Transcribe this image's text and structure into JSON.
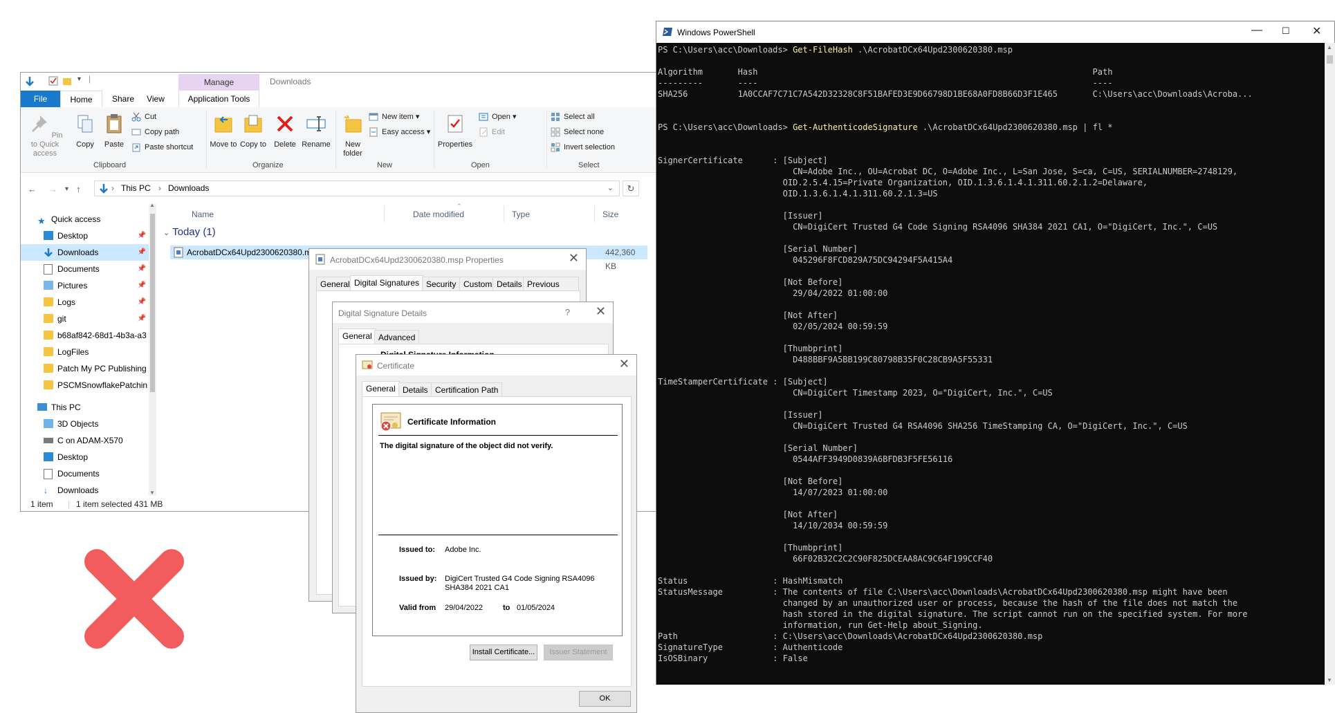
{
  "explorer": {
    "title": "Downloads",
    "manage_tab": "Manage",
    "tabs": {
      "file": "File",
      "home": "Home",
      "share": "Share",
      "view": "View",
      "app_tools": "Application Tools"
    },
    "ribbon": {
      "pin": "Pin to Quick access",
      "copy": "Copy",
      "paste": "Paste",
      "cut": "Cut",
      "copy_path": "Copy path",
      "paste_shortcut": "Paste shortcut",
      "clipboard": "Clipboard",
      "move_to": "Move to",
      "copy_to": "Copy to",
      "delete": "Delete",
      "rename": "Rename",
      "organize": "Organize",
      "new_folder": "New folder",
      "new_item": "New item",
      "easy_access": "Easy access",
      "new": "New",
      "properties": "Properties",
      "open": "Open",
      "edit": "Edit",
      "open_group": "Open",
      "select_all": "Select all",
      "select_none": "Select none",
      "invert_selection": "Invert selection",
      "select": "Select"
    },
    "breadcrumb": {
      "root": "This PC",
      "folder": "Downloads"
    },
    "nav": [
      {
        "label": "Quick access",
        "pinned": false
      },
      {
        "label": "Desktop",
        "pinned": true
      },
      {
        "label": "Downloads",
        "pinned": true
      },
      {
        "label": "Documents",
        "pinned": true
      },
      {
        "label": "Pictures",
        "pinned": true
      },
      {
        "label": "Logs",
        "pinned": true
      },
      {
        "label": "git",
        "pinned": true
      },
      {
        "label": "b68af842-68d1-4b3a-a3",
        "pinned": false
      },
      {
        "label": "LogFiles",
        "pinned": false
      },
      {
        "label": "Patch My PC Publishing",
        "pinned": false
      },
      {
        "label": "PSCMSnowflakePatchin",
        "pinned": false
      },
      {
        "label": "This PC",
        "pinned": false
      },
      {
        "label": "3D Objects",
        "pinned": false
      },
      {
        "label": "C on ADAM-X570",
        "pinned": false
      },
      {
        "label": "Desktop",
        "pinned": false
      },
      {
        "label": "Documents",
        "pinned": false
      },
      {
        "label": "Downloads",
        "pinned": false
      }
    ],
    "columns": {
      "name": "Name",
      "date": "Date modified",
      "type": "Type",
      "size": "Size"
    },
    "group": "Today (1)",
    "file": {
      "name": "AcrobatDCx64Upd2300620380.msp",
      "size": "442,360 KB"
    },
    "status": {
      "count": "1 item",
      "selected": "1 item selected  431 MB"
    }
  },
  "properties": {
    "title": "AcrobatDCx64Upd2300620380.msp Properties",
    "tabs": [
      "General",
      "Digital Signatures",
      "Security",
      "Custom",
      "Details",
      "Previous Versions"
    ]
  },
  "signature_details": {
    "title": "Digital Signature Details",
    "help": "?",
    "tabs": [
      "General",
      "Advanced"
    ],
    "heading": "Digital Signature Information"
  },
  "certificate": {
    "title": "Certificate",
    "tabs": [
      "General",
      "Details",
      "Certification Path"
    ],
    "info_title": "Certificate Information",
    "message": "The digital signature of the object did not verify.",
    "issued_to_label": "Issued to:",
    "issued_to": "Adobe Inc.",
    "issued_by_label": "Issued by:",
    "issued_by": "DigiCert Trusted G4 Code Signing RSA4096 SHA384 2021 CA1",
    "valid_from_label": "Valid from",
    "valid_from": "29/04/2022",
    "to_label": "to",
    "valid_to": "01/05/2024",
    "install_button": "Install Certificate...",
    "issuer_button": "Issuer Statement",
    "ok_button": "OK"
  },
  "powershell": {
    "title": "Windows PowerShell",
    "lines": [
      "PS C:\\Users\\acc\\Downloads> Get-FileHash .\\AcrobatDCx64Upd2300620380.msp",
      "",
      "Algorithm       Hash                                                                   Path",
      "---------       ----                                                                   ----",
      "SHA256          1A0CCAF7C71C7A542D32328C8F51BAFED3E9D66798D1BE68A0FD8B66D3F1E465       C:\\Users\\acc\\Downloads\\Acroba...",
      "",
      "",
      "PS C:\\Users\\acc\\Downloads> Get-AuthenticodeSignature .\\AcrobatDCx64Upd2300620380.msp | fl *",
      "",
      "",
      "SignerCertificate      : [Subject]",
      "                           CN=Adobe Inc., OU=Acrobat DC, O=Adobe Inc., L=San Jose, S=ca, C=US, SERIALNUMBER=2748129,",
      "                         OID.2.5.4.15=Private Organization, OID.1.3.6.1.4.1.311.60.2.1.2=Delaware,",
      "                         OID.1.3.6.1.4.1.311.60.2.1.3=US",
      "",
      "                         [Issuer]",
      "                           CN=DigiCert Trusted G4 Code Signing RSA4096 SHA384 2021 CA1, O=\"DigiCert, Inc.\", C=US",
      "",
      "                         [Serial Number]",
      "                           045296F8FCD829A75DC94294F5A415A4",
      "",
      "                         [Not Before]",
      "                           29/04/2022 01:00:00",
      "",
      "                         [Not After]",
      "                           02/05/2024 00:59:59",
      "",
      "                         [Thumbprint]",
      "                           D488BBF9A5BB199C80798B35F0C28CB9A5F55331",
      "",
      "TimeStamperCertificate : [Subject]",
      "                           CN=DigiCert Timestamp 2023, O=\"DigiCert, Inc.\", C=US",
      "",
      "                         [Issuer]",
      "                           CN=DigiCert Trusted G4 RSA4096 SHA256 TimeStamping CA, O=\"DigiCert, Inc.\", C=US",
      "",
      "                         [Serial Number]",
      "                           0544AFF3949D0839A6BFDB3F5FE56116",
      "",
      "                         [Not Before]",
      "                           14/07/2023 01:00:00",
      "",
      "                         [Not After]",
      "                           14/10/2034 00:59:59",
      "",
      "                         [Thumbprint]",
      "                           66F02B32C2C2C90F825DCEAA8AC9C64F199CCF40",
      "",
      "Status                 : HashMismatch",
      "StatusMessage          : The contents of file C:\\Users\\acc\\Downloads\\AcrobatDCx64Upd2300620380.msp might have been",
      "                         changed by an unauthorized user or process, because the hash of the file does not match the",
      "                         hash stored in the digital signature. The script cannot run on the specified system. For more",
      "                         information, run Get-Help about_Signing.",
      "Path                   : C:\\Users\\acc\\Downloads\\AcrobatDCx64Upd2300620380.msp",
      "SignatureType          : Authenticode",
      "IsOSBinary             : False"
    ]
  },
  "colors": {
    "accent": "#1979ca",
    "manage": "#e7d4f1",
    "console_bg": "#0c0c0c",
    "console_fg": "#cccccc",
    "red_x": "#f25c5c"
  },
  "icons": [
    "down-arrow-icon",
    "folder-icon",
    "pin-icon",
    "copy-icon",
    "paste-icon",
    "scissors-icon",
    "delete-icon",
    "rename-icon",
    "properties-icon",
    "select-all-icon",
    "certificate-error-icon",
    "red-x-icon",
    "powershell-icon"
  ]
}
